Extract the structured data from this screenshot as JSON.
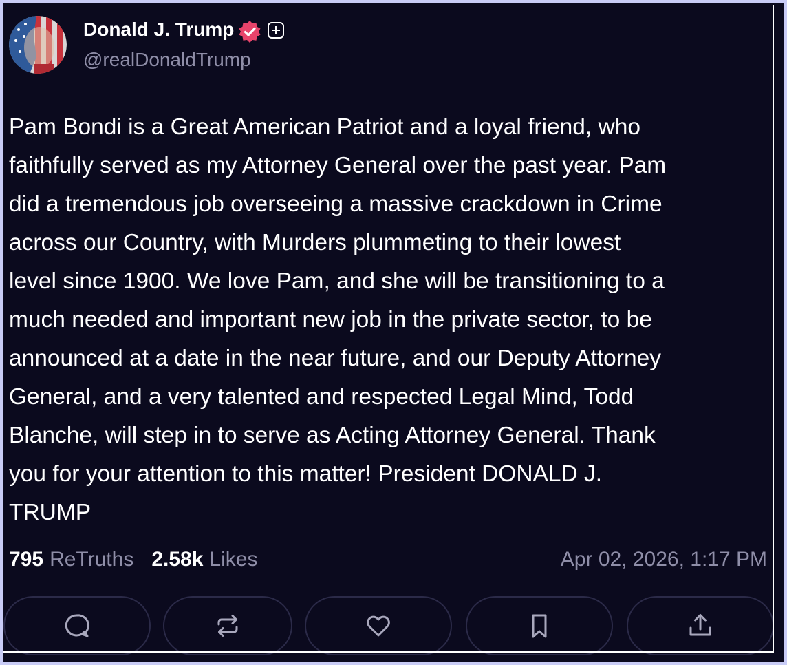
{
  "author": {
    "display_name": "Donald J. Trump",
    "handle": "@realDonaldTrump",
    "verified": true
  },
  "post": {
    "text": "Pam Bondi is a Great American Patriot and a loyal friend, who\nfaithfully served as my Attorney General over the past year. Pam\ndid a tremendous job overseeing a massive crackdown in Crime\nacross our Country, with Murders plummeting to their lowest\nlevel since 1900. We love Pam, and she will be transitioning to a\nmuch needed and important new job in the private sector, to be\nannounced at a date in the near future, and our Deputy Attorney\nGeneral, and a very talented and respected Legal Mind, Todd\nBlanche, will step in to serve as Acting Attorney General. Thank\nyou for your attention to this matter! President DONALD J.\nTRUMP",
    "retruths_count": "795",
    "retruths_label": "ReTruths",
    "likes_count": "2.58k",
    "likes_label": "Likes",
    "timestamp": "Apr 02, 2026, 1:17 PM"
  },
  "actions": [
    {
      "icon": "reply-icon"
    },
    {
      "icon": "retruth-icon"
    },
    {
      "icon": "heart-icon"
    },
    {
      "icon": "bookmark-icon"
    },
    {
      "icon": "share-icon"
    }
  ],
  "colors": {
    "background": "#0b0a1e",
    "frame_border": "#c9ccf6",
    "text_primary": "#ffffff",
    "text_muted": "#8f8ea8",
    "verified_badge": "#e8446b",
    "button_border": "#2b2a48"
  }
}
